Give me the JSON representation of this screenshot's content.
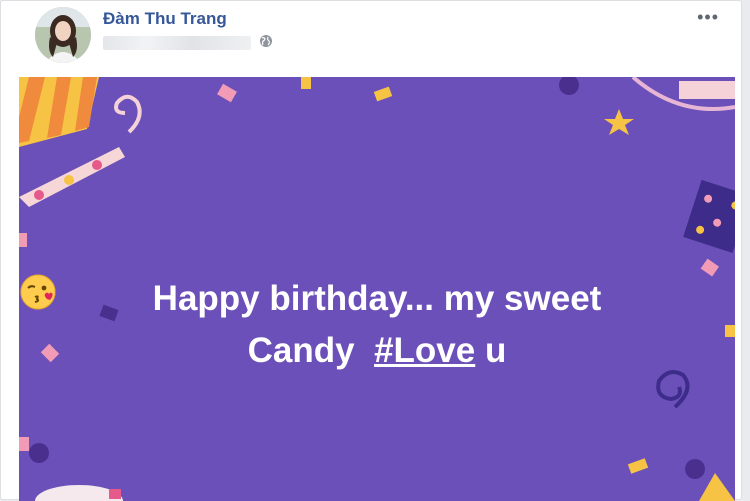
{
  "post": {
    "author": "Đàm Thu Trang",
    "more_icon": "more-dots-icon",
    "audience_icon": "globe-icon",
    "message": {
      "line1": "Happy birthday... my sweet",
      "line2_prefix": "Candy",
      "hashtag": "#Love",
      "line2_suffix": "u",
      "emojis": [
        "smiling-face-icon",
        "face-blowing-kiss-icon"
      ]
    },
    "background_color": "#6c50b9",
    "link_color": "#365899"
  }
}
